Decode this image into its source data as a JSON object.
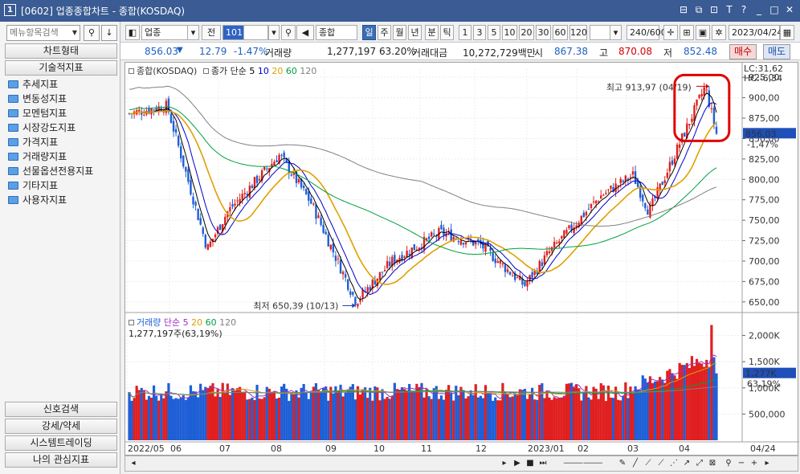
{
  "window": {
    "icon_label": "1",
    "title": "[0602] 업종종합차트 - 종합(KOSDAQ)",
    "controls": [
      "⊟",
      "⧉",
      "⊡",
      "T",
      "?",
      "_",
      "□",
      "✕"
    ]
  },
  "left_panel": {
    "search_placeholder": "메뉴항목검색",
    "tab_chart_type": "차트형태",
    "tab_tech_indicators": "기술적지표",
    "tree_items": [
      "추세지표",
      "변동성지표",
      "모멘텀지표",
      "시장강도지표",
      "가격지표",
      "거래량지표",
      "선물옵션전용지표",
      "기타지표",
      "사용자지표"
    ],
    "bottom_tabs": [
      "신호검색",
      "강세/약세",
      "시스템트레이딩",
      "나의 관심지표"
    ]
  },
  "toolbar": {
    "market_select": "업종",
    "code_prefix": "전",
    "code_value": "101",
    "index_name": "종합(KOSDAQ)",
    "periods": [
      "일",
      "주",
      "월",
      "년",
      "분",
      "틱"
    ],
    "selected_period": "일",
    "intervals": [
      "1",
      "3",
      "5",
      "10",
      "20",
      "30",
      "60",
      "120"
    ],
    "count": "240/600",
    "date": "2023/04/24"
  },
  "infobar": {
    "price": "856.03",
    "change": "12.79",
    "change_pct": "-1.47%",
    "volume_label": "거래량",
    "volume": "1,277,197",
    "volume_pct": "63.20%",
    "amount_label": "거래대금",
    "amount": "10,272,729백만",
    "open_label": "시",
    "open": "867.38",
    "high_label": "고",
    "high": "870.08",
    "low_label": "저",
    "low": "852.48",
    "buy_label": "매수",
    "sell_label": "매도"
  },
  "price_legend": {
    "name": "종합(KOSDAQ)",
    "ma_label": "종가 단순",
    "ma_periods": [
      "5",
      "10",
      "20",
      "60",
      "120"
    ]
  },
  "price_axis": {
    "labels": [
      "925,00",
      "900,00",
      "875,00",
      "850,00",
      "825,00",
      "800,00",
      "775,00",
      "750,00",
      "725,00",
      "700,00",
      "675,00",
      "650,00"
    ],
    "lc_label": "LC:31,62",
    "hc_label": "HC:-6,34",
    "current_box": "856,03",
    "current_pct": "-1,47%"
  },
  "annotations": {
    "high_label": "최고 913,97 (04/19)",
    "low_label": "최저 650,39 (10/13)"
  },
  "volume_legend": {
    "name": "거래량",
    "ma_label": "단순",
    "ma_periods": [
      "5",
      "20",
      "60",
      "120"
    ],
    "value_line": "1,277,197주(63,19%)"
  },
  "volume_axis": {
    "labels": [
      "2,000K",
      "1,500K",
      "1,000K",
      "500,000"
    ],
    "current_box": "1,277K",
    "current_pct": "63,19%"
  },
  "time_axis": {
    "labels": [
      "2022/05",
      "06",
      "07",
      "08",
      "09",
      "10",
      "11",
      "12",
      "2023/01",
      "02",
      "03",
      "04"
    ],
    "right_label": "04/24"
  },
  "colors": {
    "titlebar": "#3a5b93",
    "up": "#e02020",
    "down": "#1f5fd6",
    "ma5": "#000000",
    "ma10": "#0000cc",
    "ma20": "#e0a000",
    "ma60": "#00a040",
    "ma120": "#808080",
    "highlight": "#e00000"
  },
  "chart_data": {
    "type": "candlestick",
    "x_range": [
      "2022/05",
      "2023/04/24"
    ],
    "price_ylim": [
      640,
      935
    ],
    "volume_ylim": [
      0,
      2300000
    ],
    "price_keypoints": [
      {
        "date": "2022/05",
        "value": 880
      },
      {
        "date": "2022/06",
        "value": 890
      },
      {
        "date": "2022/07",
        "value": 715
      },
      {
        "date": "2022/07",
        "value": 760
      },
      {
        "date": "2022/08",
        "value": 830
      },
      {
        "date": "2022/09",
        "value": 770
      },
      {
        "date": "2022/10/13",
        "value": 650.39
      },
      {
        "date": "2022/11",
        "value": 700
      },
      {
        "date": "2022/11",
        "value": 735
      },
      {
        "date": "2022/12",
        "value": 720
      },
      {
        "date": "2022/12",
        "value": 670
      },
      {
        "date": "2023/01",
        "value": 710
      },
      {
        "date": "2023/02",
        "value": 780
      },
      {
        "date": "2023/03",
        "value": 805
      },
      {
        "date": "2023/03",
        "value": 760
      },
      {
        "date": "2023/04/19",
        "value": 913.97
      },
      {
        "date": "2023/04/24",
        "value": 856.03
      }
    ],
    "last_volume": 1277197,
    "max_volume_approx": 2200000
  }
}
